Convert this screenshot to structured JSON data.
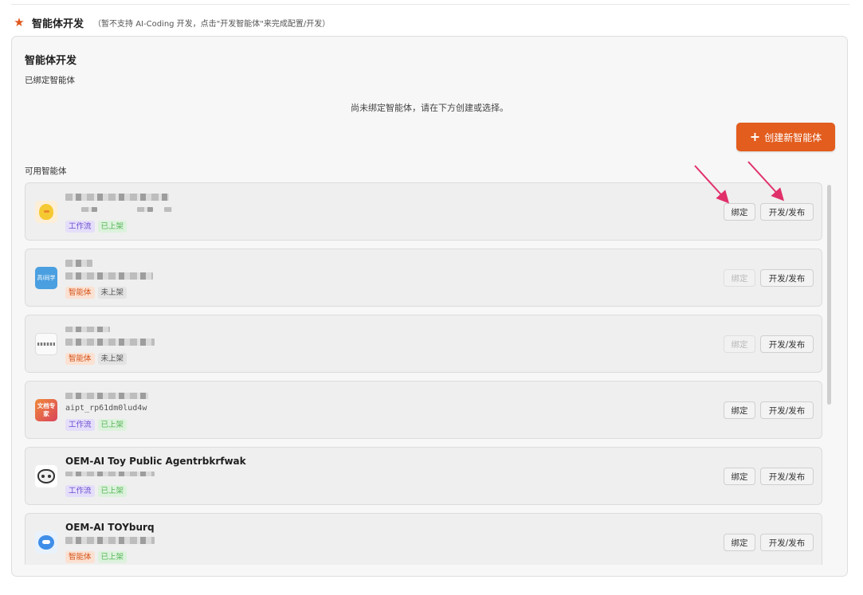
{
  "header": {
    "title": "智能体开发",
    "hint": "（暂不支持 AI-Coding 开发，点击\"开发智能体\"来完成配置/开发）"
  },
  "panel": {
    "title": "智能体开发",
    "bound_label": "已绑定智能体",
    "empty_message": "尚未绑定智能体，请在下方创建或选择。",
    "create_button": "创建新智能体",
    "available_label": "可用智能体"
  },
  "buttons": {
    "bind": "绑定",
    "develop": "开发/发布"
  },
  "agents": [
    {
      "name": "",
      "sub": "",
      "avatar": "duck-icon",
      "type": "工作流",
      "status": "已上架",
      "bind_enabled": true
    },
    {
      "name": "",
      "sub": "",
      "avatar_text": "高i同学",
      "avatar": "blue-avatar-icon",
      "type": "智能体",
      "status": "未上架",
      "bind_enabled": false
    },
    {
      "name": "",
      "sub": "",
      "avatar": "grey-avatar-icon",
      "type": "智能体",
      "status": "未上架",
      "bind_enabled": false
    },
    {
      "name": "",
      "sub": "aipt_rp61dm0lud4w",
      "avatar_text": "文档专家",
      "avatar": "doc-avatar-icon",
      "type": "工作流",
      "status": "已上架",
      "bind_enabled": true
    },
    {
      "name": "OEM-AI Toy Public Agentrbkrfwak",
      "sub": "",
      "avatar": "cat-icon",
      "type": "工作流",
      "status": "已上架",
      "bind_enabled": true
    },
    {
      "name": "OEM-AI TOYburq",
      "sub": "",
      "avatar": "robot-icon",
      "type": "智能体",
      "status": "已上架",
      "bind_enabled": true
    }
  ],
  "colors": {
    "accent": "#e25d1e",
    "annotation_arrow": "#e0306a"
  }
}
